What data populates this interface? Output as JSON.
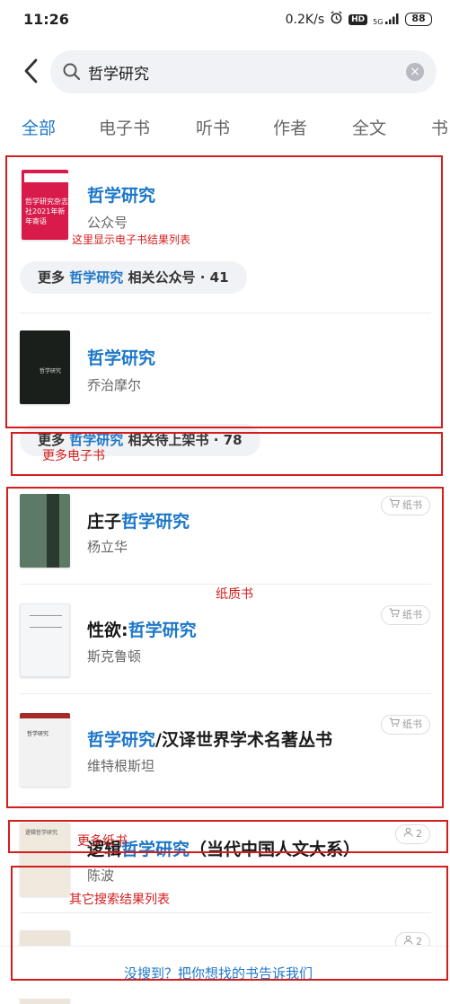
{
  "status_bar": {
    "time": "11:26",
    "network_speed": "0.2K/s",
    "hd": "HD",
    "net": "5G",
    "battery": "88"
  },
  "search": {
    "query": "哲学研究"
  },
  "tabs": [
    "全部",
    "电子书",
    "听书",
    "作者",
    "全文",
    "书"
  ],
  "results": {
    "official_account": {
      "title_hl": "哲学研究",
      "subtitle": "公众号",
      "cover_text": "哲学研究杂志社2021年新年寄语"
    },
    "more_accounts": {
      "prefix": "更多",
      "keyword": "哲学研究",
      "suffix": "相关公众号 · 41"
    },
    "ebook": {
      "title_hl": "哲学研究",
      "subtitle": "乔治摩尔"
    },
    "more_ebooks": {
      "prefix": "更多",
      "keyword": "哲学研究",
      "suffix": "相关待上架书 · 78"
    },
    "paper_books": [
      {
        "title_prefix": "庄子",
        "title_hl": "哲学研究",
        "title_suffix": "",
        "author": "杨立华",
        "badge": "纸书"
      },
      {
        "title_prefix": "性欲:",
        "title_hl": "哲学研究",
        "title_suffix": "",
        "author": "斯克鲁顿",
        "badge": "纸书"
      },
      {
        "title_prefix": "",
        "title_hl": "哲学研究",
        "title_suffix": "/汉译世界学术名著丛书",
        "author": "维特根斯坦",
        "badge": "纸书"
      }
    ],
    "other": [
      {
        "title_prefix": "逻辑",
        "title_hl": "哲学研究",
        "title_suffix": "（当代中国人文大系）",
        "author": "陈波",
        "count": "2"
      },
      {
        "count": "2"
      }
    ]
  },
  "annotations": {
    "ebook_list": "这里显示电子书结果列表",
    "more_ebooks": "更多电子书",
    "paper_books": "纸质书",
    "more_paper": "更多纸书",
    "other_results": "其它搜索结果列表"
  },
  "footer": {
    "feedback": "没搜到？把你想找的书告诉我们"
  },
  "colors": {
    "accent": "#1d77c9",
    "annotation": "#d41d1d"
  }
}
